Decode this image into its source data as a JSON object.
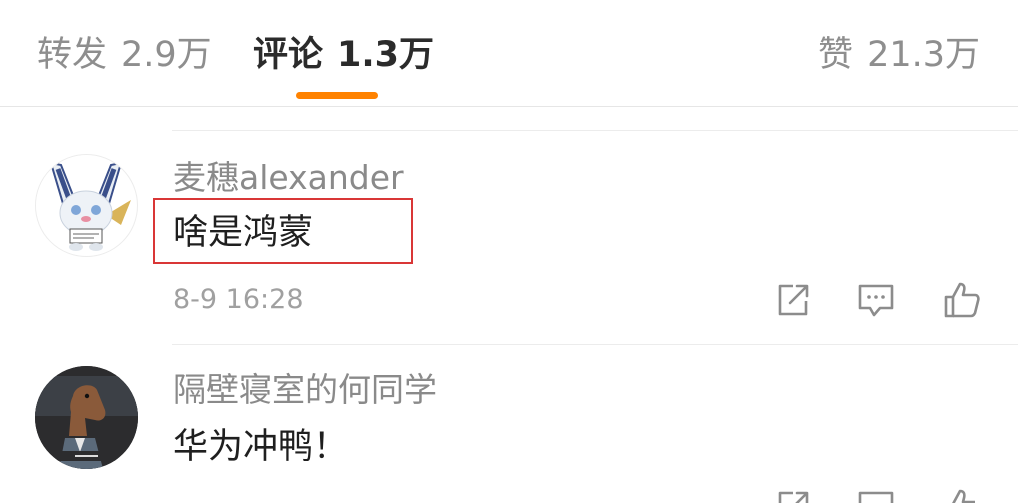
{
  "tabs": {
    "repost": {
      "label": "转发",
      "count": "2.9万"
    },
    "comment": {
      "label": "评论",
      "count": "1.3万"
    },
    "like": {
      "label": "赞",
      "count": "21.3万"
    }
  },
  "comments": [
    {
      "username": "麦穗alexander",
      "content": "啥是鸿蒙",
      "timestamp": "8-9 16:28",
      "highlighted": true
    },
    {
      "username": "隔壁寝室的何同学",
      "content": "华为冲鸭！"
    }
  ],
  "icons": {
    "share": "share-square-arrow-icon",
    "reply": "comment-bubble-icon",
    "like": "thumbs-up-icon"
  },
  "colors": {
    "accent": "#ff8200",
    "highlight_box": "#d93636",
    "text_primary": "#1f1f1f",
    "text_secondary": "#8a8a8a"
  }
}
